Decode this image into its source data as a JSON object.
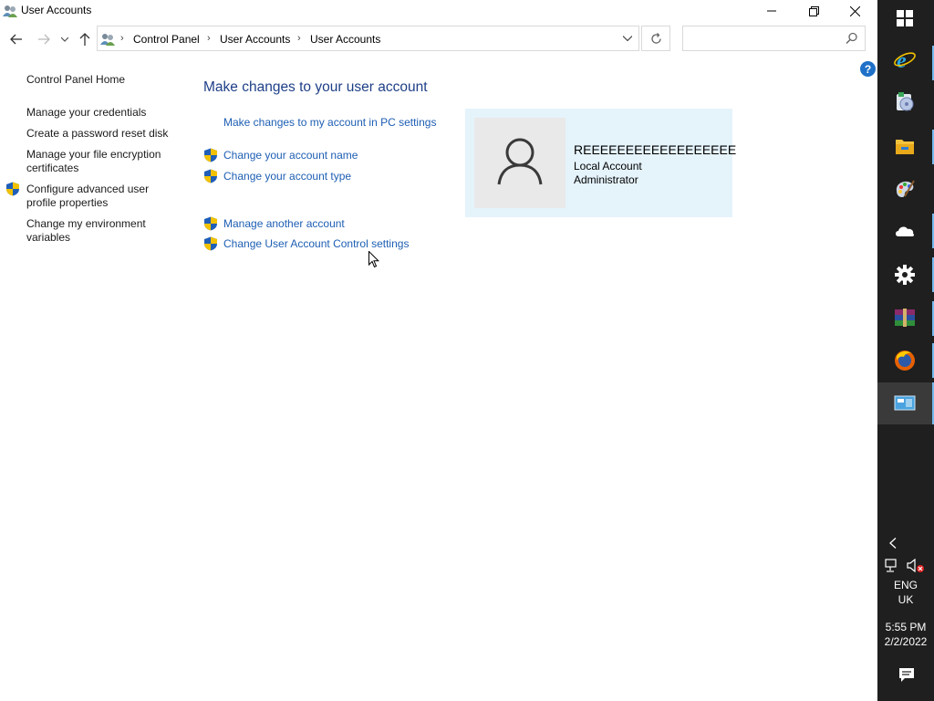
{
  "window": {
    "title": "User Accounts",
    "controls": {
      "minimize": "minimize",
      "maximize": "restore",
      "close": "close"
    }
  },
  "address": {
    "crumbs": [
      "Control Panel",
      "User Accounts",
      "User Accounts"
    ],
    "separator": "›",
    "search_placeholder": ""
  },
  "left_pane": {
    "home": "Control Panel Home",
    "links": [
      "Manage your credentials",
      "Create a password reset disk",
      "Manage your file encryption certificates",
      "Configure advanced user profile properties",
      "Change my environment variables"
    ]
  },
  "main": {
    "heading": "Make changes to your user account",
    "pc_settings_link": "Make changes to my account in PC settings",
    "tasks": [
      "Change your account name",
      "Change your account type",
      "Manage another account",
      "Change User Account Control settings"
    ]
  },
  "account": {
    "name": "REEEEEEEEEEEEEEEEEE",
    "type": "Local Account",
    "role": "Administrator"
  },
  "taskbar": {
    "icons": [
      "windows-start-icon",
      "internet-explorer-icon",
      "media-player-icon",
      "file-explorer-icon",
      "paint-icon",
      "onedrive-icon",
      "settings-gear-icon",
      "winrar-icon",
      "firefox-icon",
      "control-panel-icon"
    ],
    "tray": {
      "language": "ENG",
      "region": "UK",
      "time": "5:55 PM",
      "date": "2/2/2022"
    }
  },
  "colors": {
    "link": "#1d5eb3",
    "heading": "#1e3f87",
    "tile_bg": "#e5f3fb",
    "taskbar_bg": "#1f1f1f"
  }
}
